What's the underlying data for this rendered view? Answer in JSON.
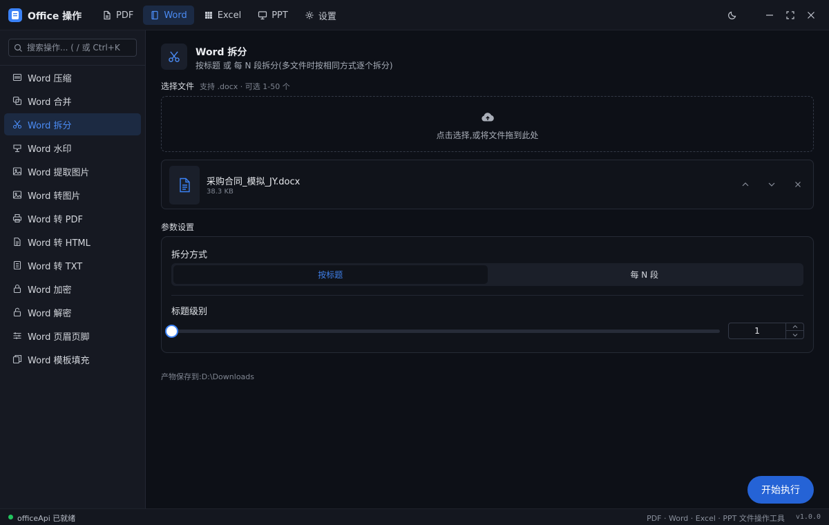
{
  "app": {
    "title": "Office 操作",
    "logo_icon": "document-stack-icon",
    "accent": "#3b82f6"
  },
  "tabs": [
    {
      "label": "PDF",
      "icon": "file-icon",
      "active": false
    },
    {
      "label": "Word",
      "icon": "document-icon",
      "active": true
    },
    {
      "label": "Excel",
      "icon": "grid-icon",
      "active": false
    },
    {
      "label": "PPT",
      "icon": "presentation-icon",
      "active": false
    },
    {
      "label": "设置",
      "icon": "gear-icon",
      "active": false
    }
  ],
  "window_controls": [
    "moon-icon",
    "minimize-icon",
    "maximize-icon",
    "close-icon"
  ],
  "sidebar": {
    "search_placeholder": "搜索操作... ( / 或 Ctrl+K",
    "items": [
      {
        "label": "Word 压缩",
        "icon": "compress-icon",
        "active": false
      },
      {
        "label": "Word 合并",
        "icon": "merge-icon",
        "active": false
      },
      {
        "label": "Word 拆分",
        "icon": "scissors-icon",
        "active": true
      },
      {
        "label": "Word 水印",
        "icon": "watermark-icon",
        "active": false
      },
      {
        "label": "Word 提取图片",
        "icon": "image-icon",
        "active": false
      },
      {
        "label": "Word 转图片",
        "icon": "image-icon",
        "active": false
      },
      {
        "label": "Word 转 PDF",
        "icon": "printer-icon",
        "active": false
      },
      {
        "label": "Word 转 HTML",
        "icon": "html-file-icon",
        "active": false
      },
      {
        "label": "Word 转 TXT",
        "icon": "text-file-icon",
        "active": false
      },
      {
        "label": "Word 加密",
        "icon": "lock-icon",
        "active": false
      },
      {
        "label": "Word 解密",
        "icon": "unlock-icon",
        "active": false
      },
      {
        "label": "Word 页眉页脚",
        "icon": "sliders-icon",
        "active": false
      },
      {
        "label": "Word 模板填充",
        "icon": "template-icon",
        "active": false
      }
    ]
  },
  "main": {
    "title": "Word 拆分",
    "title_icon": "scissors-icon",
    "subtitle": "按标题 或 每 N 段拆分(多文件时按相同方式逐个拆分)",
    "select_label": "选择文件",
    "select_hint": "支持 .docx · 可选 1-50 个",
    "dropzone_text": "点击选择,或将文件拖到此处",
    "dropzone_icon": "cloud-upload-icon",
    "file": {
      "name": "采购合同_模拟_JY.docx",
      "size": "38.3 KB",
      "icon": "document-icon",
      "actions": [
        "chevron-up-icon",
        "chevron-down-icon",
        "close-icon"
      ]
    },
    "params_label": "参数设置",
    "split_mode_label": "拆分方式",
    "split_modes": [
      {
        "label": "按标题",
        "active": true
      },
      {
        "label": "每 N 段",
        "active": false
      }
    ],
    "heading_level_label": "标题级别",
    "heading_level_value": "1",
    "heading_level_fraction": 0,
    "save_path": "产物保存到:D:\\Downloads",
    "run_button": "开始执行"
  },
  "status": {
    "text": "officeApi 已就绪",
    "color": "#22c55e",
    "right": "PDF · Word · Excel · PPT 文件操作工具",
    "version": "v1.0.0"
  }
}
